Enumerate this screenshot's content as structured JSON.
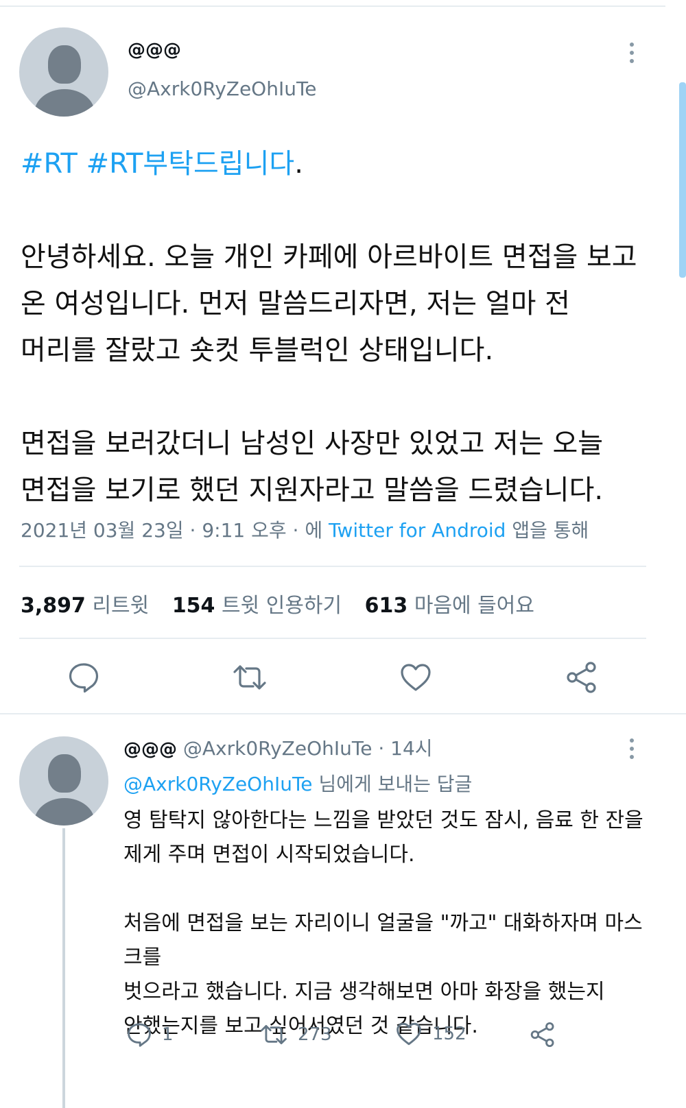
{
  "tweet": {
    "author": {
      "name": "@@@",
      "handle": "@Axrk0RyZeOhIuTe"
    },
    "hashtags": [
      "#RT",
      "#RT부탁드립니다"
    ],
    "hashtag_suffix": ".",
    "paragraphs": [
      [
        "안녕하세요. 오늘 개인 카페에 아르바이트 면접을 보고",
        "온 여성입니다. 먼저 말씀드리자면, 저는 얼마 전",
        "머리를 잘랐고 숏컷 투블럭인 상태입니다."
      ],
      [
        "면접을 보러갔더니 남성인 사장만 있었고 저는 오늘",
        "면접을 보기로 했던 지원자라고 말씀을 드렸습니다."
      ]
    ],
    "meta": {
      "date": "2021년 03월 23일",
      "sep1": "·",
      "time": "9:11 오후",
      "sep2": "·",
      "via_prefix": "에",
      "source": "Twitter for Android",
      "via_suffix": "앱을 통해"
    },
    "stats": {
      "retweets": "3,897",
      "retweets_label": "리트윗",
      "quotes": "154",
      "quotes_label": "트윗 인용하기",
      "likes": "613",
      "likes_label": "마음에 들어요"
    },
    "actions": [
      "reply-icon",
      "retweet-icon",
      "like-icon",
      "share-icon"
    ]
  },
  "reply": {
    "author": {
      "name": "@@@",
      "handle": "@Axrk0RyZeOhIuTe"
    },
    "sep": "·",
    "time": "14시",
    "reply_to_handle": "@Axrk0RyZeOhIuTe",
    "reply_to_suffix": "님에게 보내는 답글",
    "paragraphs": [
      [
        "영 탐탁지 않아한다는 느낌을 받았던 것도 잠시, 음료 한 잔을",
        "제게 주며 면접이 시작되었습니다."
      ],
      [
        "처음에 면접을 보는 자리이니 얼굴을 \"까고\" 대화하자며 마스크를",
        "벗으라고 했습니다. 지금 생각해보면 아마 화장을 했는지",
        "안했는지를 보고 싶어서였던 것 같습니다."
      ]
    ],
    "counts": {
      "replies": "1",
      "retweets": "273",
      "likes": "152"
    }
  },
  "colors": {
    "accent": "#1da1f2",
    "muted": "#657786",
    "text": "#0f1419",
    "divider": "#e6ecf0"
  }
}
